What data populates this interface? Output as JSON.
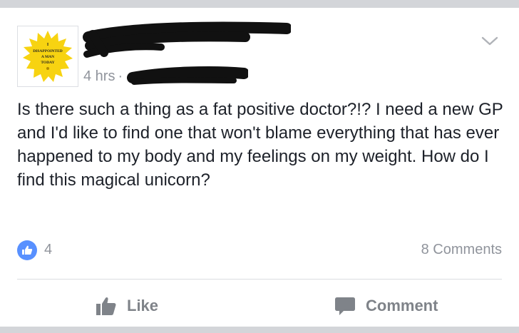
{
  "post": {
    "avatar_text": [
      "I",
      "DISAPPOINTED",
      "A MAN",
      "TODAY"
    ],
    "timestamp": "4 hrs",
    "separator": "·",
    "text": "Is there such a thing as a fat positive doctor?!? I need a new GP and I'd like to find one that won't blame everything that has ever happened to my body and my feelings on my weight. How do I find this magical unicorn?"
  },
  "stats": {
    "like_count": "4",
    "comments_label": "8 Comments"
  },
  "actions": {
    "like_label": "Like",
    "comment_label": "Comment"
  },
  "colors": {
    "like_badge": "#5890ff",
    "muted_text": "#90949c",
    "body_text": "#1d2129",
    "avatar_sun": "#f7d311"
  },
  "icons": {
    "options": "chevron-down-icon",
    "like_badge": "thumbs-up-icon",
    "like_action": "thumbs-up-icon",
    "comment_action": "speech-bubble-icon"
  }
}
